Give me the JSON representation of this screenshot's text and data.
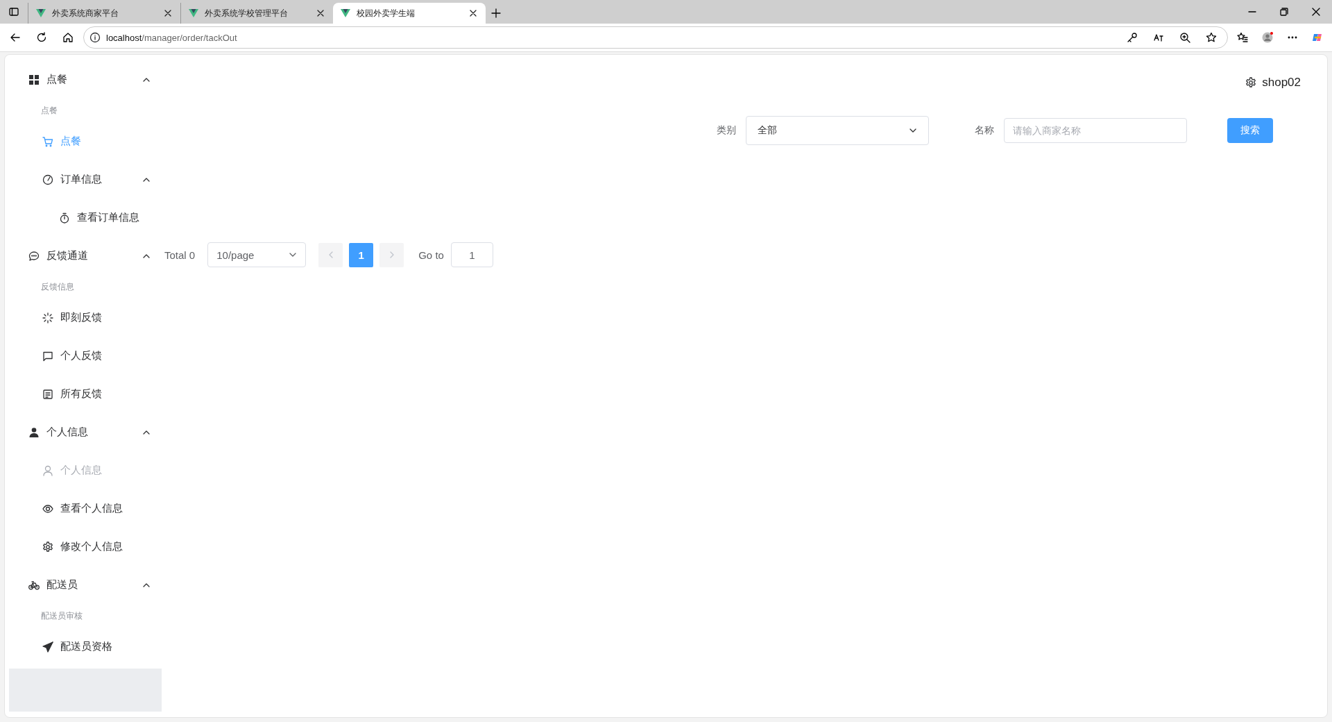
{
  "browser": {
    "tabs": [
      {
        "title": "外卖系统商家平台",
        "selected": false
      },
      {
        "title": "外卖系统学校管理平台",
        "selected": false
      },
      {
        "title": "校园外卖学生端",
        "selected": true
      }
    ],
    "address": {
      "host": "localhost",
      "path": "/manager/order/tackOut"
    }
  },
  "sidebar": {
    "menu": [
      {
        "kind": "submenu",
        "label": "点餐",
        "expanded": true,
        "children": [
          {
            "kind": "group_title",
            "label": "点餐",
            "children": [
              {
                "kind": "item",
                "label": "点餐",
                "selected": true,
                "disabled": false
              }
            ]
          },
          {
            "kind": "submenu",
            "label": "订单信息",
            "expanded": true,
            "children": [
              {
                "kind": "item",
                "label": "查看订单信息",
                "selected": false,
                "disabled": false
              }
            ]
          }
        ]
      },
      {
        "kind": "submenu",
        "label": "反馈通道",
        "expanded": true,
        "children": [
          {
            "kind": "group_title",
            "label": "反馈信息",
            "children": [
              {
                "kind": "item",
                "label": "即刻反馈",
                "selected": false,
                "disabled": false
              },
              {
                "kind": "item",
                "label": "个人反馈",
                "selected": false,
                "disabled": false
              },
              {
                "kind": "item",
                "label": "所有反馈",
                "selected": false,
                "disabled": false
              }
            ]
          }
        ]
      },
      {
        "kind": "submenu",
        "label": "个人信息",
        "expanded": true,
        "children": [
          {
            "kind": "item",
            "label": "个人信息",
            "selected": false,
            "disabled": true
          },
          {
            "kind": "item",
            "label": "查看个人信息",
            "selected": false,
            "disabled": false
          },
          {
            "kind": "item",
            "label": "修改个人信息",
            "selected": false,
            "disabled": false
          }
        ]
      },
      {
        "kind": "submenu",
        "label": "配送员",
        "expanded": true,
        "children": [
          {
            "kind": "group_title",
            "label": "配送员审核",
            "children": [
              {
                "kind": "item",
                "label": "配送员资格",
                "selected": false,
                "disabled": false
              }
            ]
          }
        ]
      }
    ]
  },
  "header": {
    "user": "shop02"
  },
  "filter": {
    "category_label": "类别",
    "category_value": "全部",
    "name_label": "名称",
    "name_placeholder": "请输入商家名称",
    "search_button": "搜索"
  },
  "pagination": {
    "total": "Total 0",
    "page_size": "10/page",
    "prev_disabled": true,
    "pages": [
      {
        "label": "1",
        "selected": true
      }
    ],
    "next_disabled": true,
    "goto_label": "Go to",
    "goto_value": "1"
  }
}
